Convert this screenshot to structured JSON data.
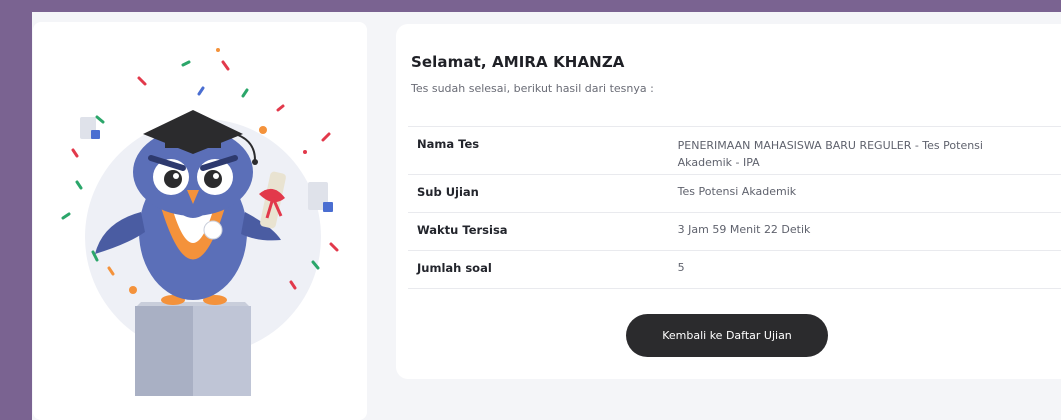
{
  "greeting": "Selamat, AMIRA KHANZA",
  "subtitle": "Tes sudah selesai, berikut hasil dari tesnya :",
  "results": [
    {
      "label": "Nama Tes",
      "value": "PENERIMAAN MAHASISWA BARU REGULER - Tes Potensi Akademik - IPA"
    },
    {
      "label": "Sub Ujian",
      "value": "Tes Potensi Akademik"
    },
    {
      "label": "Waktu Tersisa",
      "value": "3 Jam 59 Menit 22 Detik"
    },
    {
      "label": "Jumlah soal",
      "value": "5"
    }
  ],
  "back_button_label": "Kembali ke Daftar Ujian",
  "colors": {
    "frame": "#7a6391",
    "button": "#2b2b2d",
    "owl_blue": "#5b6fb8",
    "owl_orange": "#f4923b"
  }
}
